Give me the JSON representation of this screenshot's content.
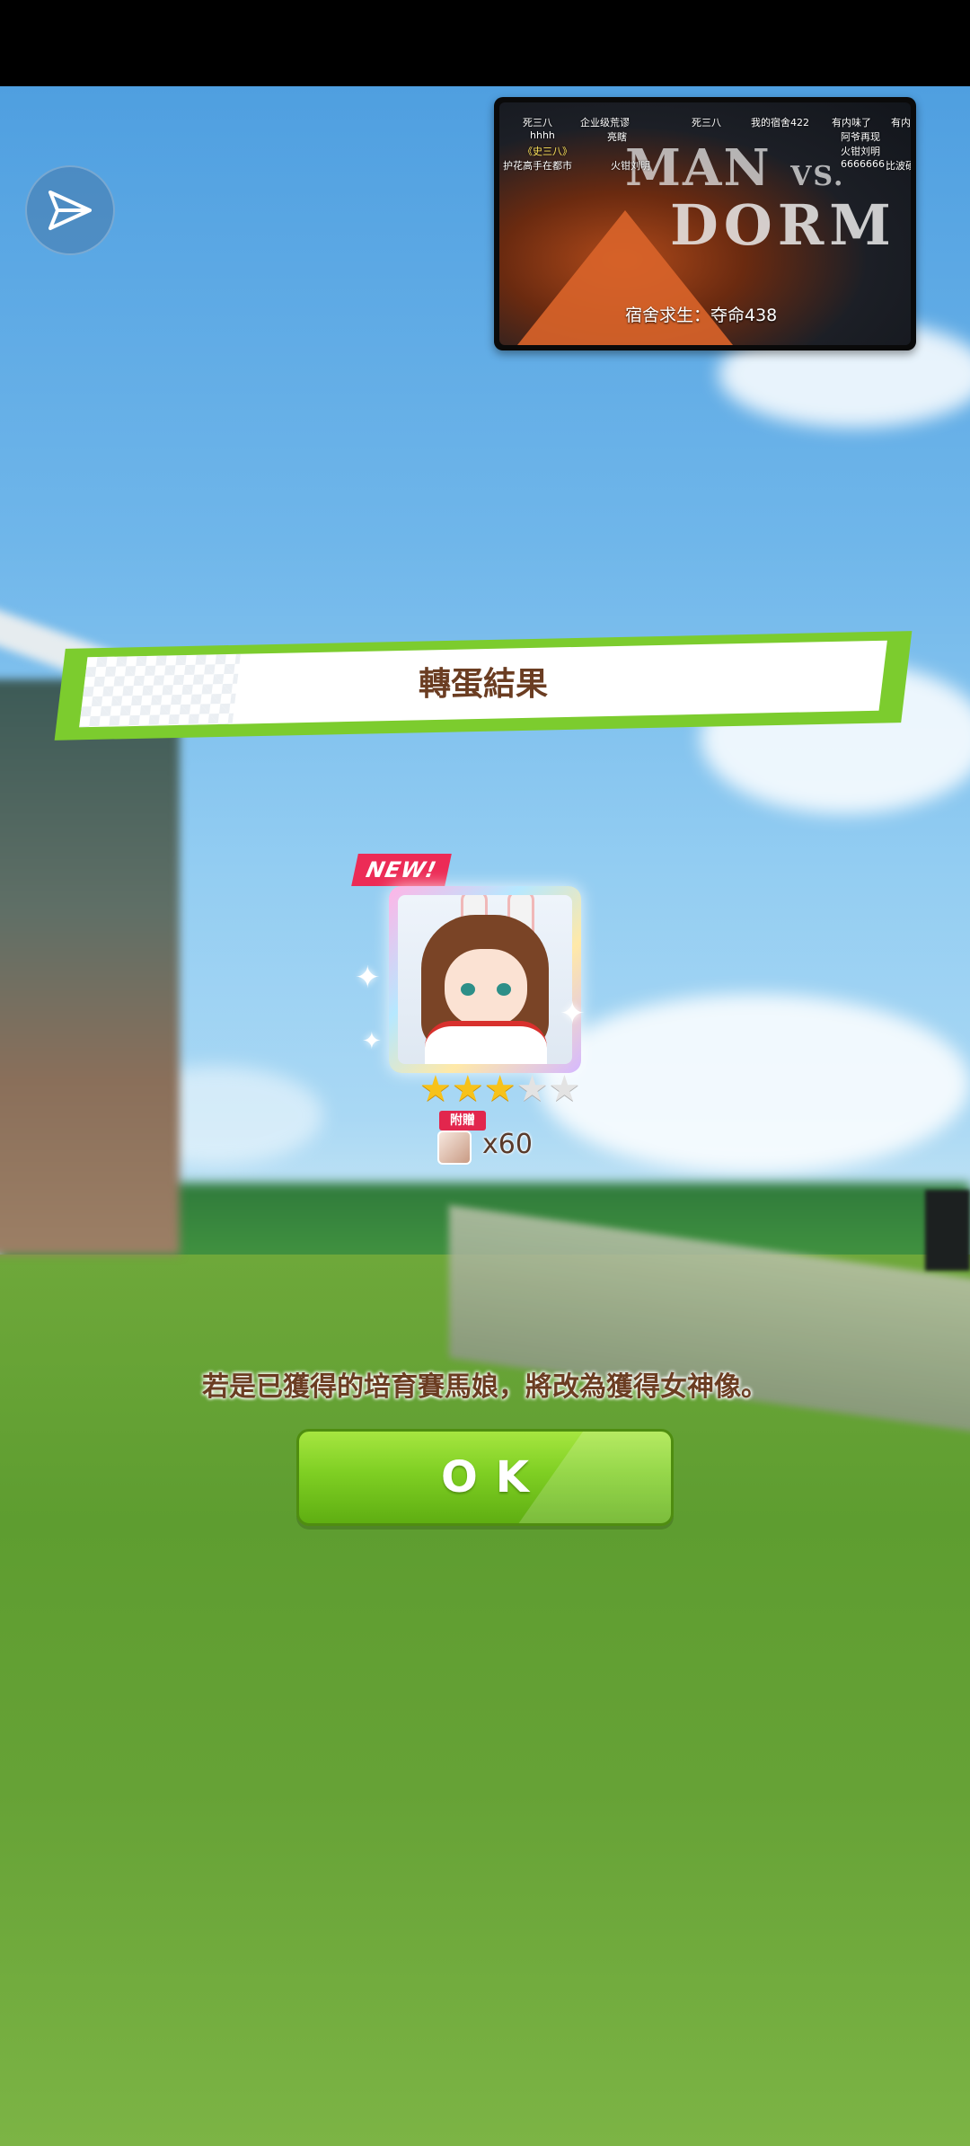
{
  "pip_video": {
    "logo_line1": "MAN",
    "logo_vs": "VS.",
    "logo_line2": "DORM",
    "caption": "宿舍求生：夺命438",
    "danmaku": [
      {
        "text": "死三八",
        "style": ""
      },
      {
        "text": "企业级荒谬",
        "style": ""
      },
      {
        "text": "死三八",
        "style": ""
      },
      {
        "text": "我的宿舍422",
        "style": ""
      },
      {
        "text": "有内味了",
        "style": ""
      },
      {
        "text": "有内",
        "style": ""
      },
      {
        "text": "hhhh",
        "style": ""
      },
      {
        "text": "亮瞎",
        "style": ""
      },
      {
        "text": "阿爷再现",
        "style": ""
      },
      {
        "text": "《史三八》",
        "style": "y"
      },
      {
        "text": "火钳刘明",
        "style": ""
      },
      {
        "text": "护花高手在都市",
        "style": ""
      },
      {
        "text": "火钳刘明",
        "style": ""
      },
      {
        "text": "6666666",
        "style": ""
      },
      {
        "text": "比波硬",
        "style": ""
      }
    ]
  },
  "banner": {
    "title": "轉蛋結果"
  },
  "result": {
    "new_tag": "NEW!",
    "stars_filled": 3,
    "stars_total": 5,
    "bonus_tag": "附贈",
    "quantity": "x60"
  },
  "notice": "若是已獲得的培育賽馬娘，將改為獲得女神像。",
  "ok_button": {
    "label": "OK"
  },
  "colors": {
    "accent_green": "#7ccc2e",
    "title_brown": "#6b3d22",
    "new_pink": "#ec2b56"
  }
}
